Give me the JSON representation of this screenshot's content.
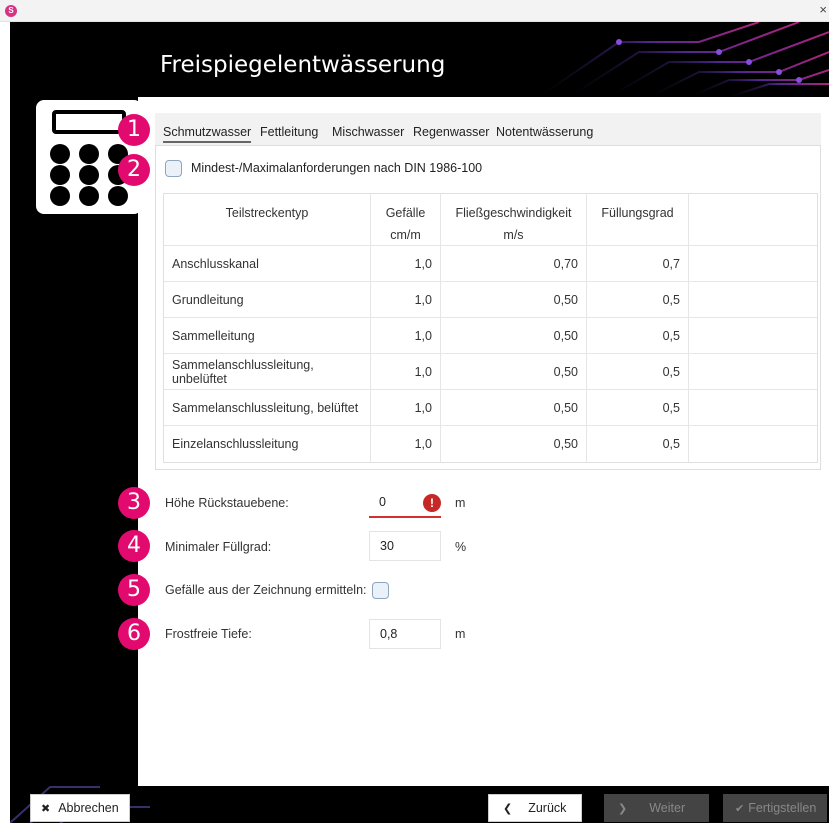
{
  "window": {
    "close_glyph": "×"
  },
  "page": {
    "title": "Freispiegelentwässerung"
  },
  "badges": [
    "1",
    "2",
    "3",
    "4",
    "5",
    "6"
  ],
  "tabs": [
    {
      "label": "Schmutzwasser",
      "active": true
    },
    {
      "label": "Fettleitung",
      "active": false
    },
    {
      "label": "Mischwasser",
      "active": false
    },
    {
      "label": "Regenwasser",
      "active": false
    },
    {
      "label": "Notentwässerung",
      "active": false
    }
  ],
  "din_checkbox": {
    "label": "Mindest-/Maximalanforderungen nach DIN 1986-100",
    "checked": false
  },
  "table": {
    "headers": {
      "typ": "Teilstreckentyp",
      "gefaelle": "Gefälle",
      "gefaelle_unit": "cm/m",
      "geschw": "Fließgeschwindigkeit",
      "geschw_unit": "m/s",
      "fuellung": "Füllungsgrad"
    },
    "rows": [
      {
        "typ": "Anschlusskanal",
        "gefaelle": "1,0",
        "geschw": "0,70",
        "fuellung": "0,7"
      },
      {
        "typ": "Grundleitung",
        "gefaelle": "1,0",
        "geschw": "0,50",
        "fuellung": "0,5"
      },
      {
        "typ": "Sammelleitung",
        "gefaelle": "1,0",
        "geschw": "0,50",
        "fuellung": "0,5"
      },
      {
        "typ": "Sammelanschlussleitung, unbelüftet",
        "gefaelle": "1,0",
        "geschw": "0,50",
        "fuellung": "0,5"
      },
      {
        "typ": "Sammelanschlussleitung, belüftet",
        "gefaelle": "1,0",
        "geschw": "0,50",
        "fuellung": "0,5"
      },
      {
        "typ": "Einzelanschlussleitung",
        "gefaelle": "1,0",
        "geschw": "0,50",
        "fuellung": "0,5"
      }
    ]
  },
  "fields": {
    "rueckstau": {
      "label": "Höhe Rückstauebene:",
      "value": "0",
      "unit": "m",
      "error_glyph": "!"
    },
    "fuellgrad": {
      "label": "Minimaler Füllgrad:",
      "value": "30",
      "unit": "%"
    },
    "gefaelle_zeichnung": {
      "label": "Gefälle aus der Zeichnung ermitteln:",
      "checked": false
    },
    "frostfrei": {
      "label": "Frostfreie Tiefe:",
      "value": "0,8",
      "unit": "m"
    }
  },
  "footer": {
    "cancel": {
      "icon": "✖",
      "label": "Abbrechen"
    },
    "back": {
      "icon": "❮",
      "label": "Zurück"
    },
    "next": {
      "icon": "❯",
      "label": "Weiter",
      "disabled": true
    },
    "finish": {
      "icon": "✔",
      "label": "Fertigstellen",
      "disabled": true
    }
  },
  "colors": {
    "badge": "#e30a6f",
    "error": "#d32f2f",
    "frame": "#000000",
    "accent_art": "#7a2bd6"
  }
}
